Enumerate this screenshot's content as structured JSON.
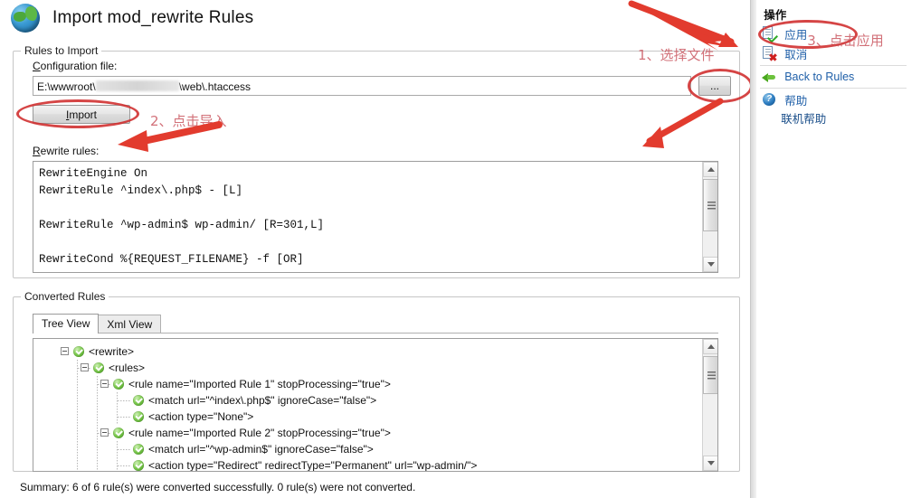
{
  "window": {
    "title": "Import mod_rewrite Rules",
    "icon": "globe-icon"
  },
  "import_group": {
    "legend": "Rules to Import",
    "config_label_pre": "C",
    "config_label_rest": "onfiguration file:",
    "config_path_prefix": "E:\\wwwroot\\",
    "config_path_suffix": "\\web\\.htaccess",
    "browse_button": "...",
    "import_button_pre": "I",
    "import_button_rest": "mport",
    "rewrite_label_pre": "R",
    "rewrite_label_rest": "ewrite rules:",
    "rewrite_rules_text": "RewriteEngine On\nRewriteRule ^index\\.php$ - [L]\n\nRewriteRule ^wp-admin$ wp-admin/ [R=301,L]\n\nRewriteCond %{REQUEST_FILENAME} -f [OR]"
  },
  "converted_group": {
    "legend": "Converted Rules",
    "tabs": [
      {
        "label": "Tree View",
        "active": true
      },
      {
        "label": "Xml View",
        "active": false
      }
    ],
    "tree": [
      {
        "indent": 0,
        "expander": true,
        "text": "<rewrite>"
      },
      {
        "indent": 1,
        "expander": true,
        "text": "<rules>"
      },
      {
        "indent": 2,
        "expander": true,
        "text": "<rule name=\"Imported Rule 1\" stopProcessing=\"true\">"
      },
      {
        "indent": 3,
        "expander": false,
        "text": "<match url=\"^index\\.php$\" ignoreCase=\"false\">"
      },
      {
        "indent": 3,
        "expander": false,
        "text": "<action type=\"None\">"
      },
      {
        "indent": 2,
        "expander": true,
        "text": "<rule name=\"Imported Rule 2\" stopProcessing=\"true\">"
      },
      {
        "indent": 3,
        "expander": false,
        "text": "<match url=\"^wp-admin$\" ignoreCase=\"false\">"
      },
      {
        "indent": 3,
        "expander": false,
        "text": "<action type=\"Redirect\" redirectType=\"Permanent\" url=\"wp-admin/\">"
      }
    ]
  },
  "summary": "Summary: 6 of 6 rule(s) were converted successfully. 0 rule(s) were not converted.",
  "sidebar": {
    "title": "操作",
    "items": [
      {
        "label": "应用",
        "icon": "page-check-icon"
      },
      {
        "label": "取消",
        "icon": "page-x-icon"
      },
      {
        "label": "Back to Rules",
        "icon": "back-arrow-icon"
      },
      {
        "label": "帮助",
        "icon": "help-question-icon"
      },
      {
        "label": "联机帮助",
        "icon": "none"
      }
    ]
  },
  "annotations": [
    {
      "text": "1、选择文件"
    },
    {
      "text": "2、点击导入"
    },
    {
      "text": "3、点击应用"
    }
  ],
  "colors": {
    "annotation": "#c9525c",
    "marker": "#cf2b2b",
    "link": "#1f5fa8",
    "tree_node_green": "#4aa81f"
  }
}
